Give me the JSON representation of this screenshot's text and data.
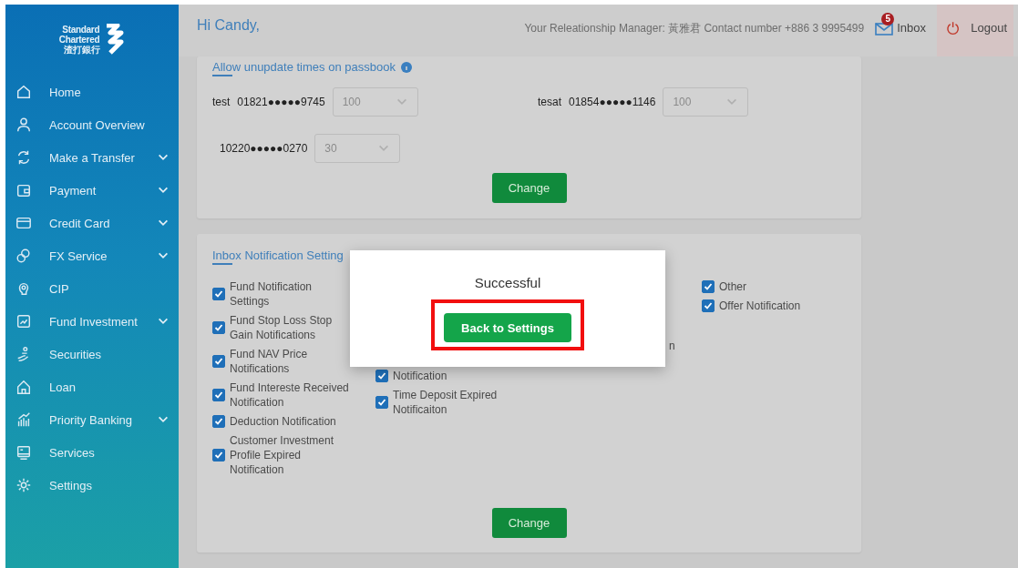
{
  "sidebar": {
    "logo": {
      "line_1": "Standard",
      "line_2": "Chartered",
      "line_3": "渣打銀行"
    },
    "items": [
      {
        "label": "Home",
        "expandable": false
      },
      {
        "label": "Account Overview",
        "expandable": false
      },
      {
        "label": "Make a Transfer",
        "expandable": true
      },
      {
        "label": "Payment",
        "expandable": true
      },
      {
        "label": "Credit Card",
        "expandable": true
      },
      {
        "label": "FX Service",
        "expandable": true
      },
      {
        "label": "CIP",
        "expandable": false
      },
      {
        "label": "Fund Investment",
        "expandable": true
      },
      {
        "label": "Securities",
        "expandable": false
      },
      {
        "label": "Loan",
        "expandable": false
      },
      {
        "label": "Priority Banking",
        "expandable": true
      },
      {
        "label": "Services",
        "expandable": false
      },
      {
        "label": "Settings",
        "expandable": false
      }
    ]
  },
  "header": {
    "greeting": "Hi Candy,",
    "manager_info": "Your Releationship Manager: 黃雅君 Contact number +886 3 9995499",
    "inbox_label": "Inbox",
    "inbox_count": "5",
    "logout_label": "Logout"
  },
  "passbook_card": {
    "title": "Allow unupdate times on passbook",
    "accounts": [
      {
        "name": "test",
        "number": "01821●●●●●9745",
        "value": "100"
      },
      {
        "name": "tesat",
        "number": "01854●●●●●1146",
        "value": "100"
      },
      {
        "number": "10220●●●●●0270",
        "value": "30"
      }
    ],
    "button": "Change"
  },
  "notification_card": {
    "title": "Inbox Notification Setting",
    "columns": [
      [
        {
          "kind": "checkbox",
          "label": "Fund Notification Settings",
          "checked": true
        },
        {
          "kind": "checkbox",
          "label": "Fund Stop Loss Stop Gain Notifications",
          "checked": true
        },
        {
          "kind": "checkbox",
          "label": "Fund NAV Price Notifications",
          "checked": true
        },
        {
          "kind": "checkbox",
          "label": "Fund Intereste Received Notification",
          "checked": true
        },
        {
          "kind": "checkbox",
          "label": "Deduction Notification",
          "checked": true
        },
        {
          "kind": "checkbox",
          "label": "Customer Investment Profile Expired Notification",
          "checked": true
        }
      ],
      [
        {
          "kind": "checkbox",
          "label": "Notification",
          "checked": true
        },
        {
          "kind": "checkbox",
          "label": "Time Deposit Expired Notificaiton",
          "checked": true
        }
      ],
      [
        {
          "kind": "fragment",
          "label": "n"
        }
      ],
      [
        {
          "kind": "checkbox",
          "label": "Other",
          "checked": true
        },
        {
          "kind": "checkbox",
          "label": "Offer Notification",
          "checked": true
        }
      ]
    ],
    "button": "Change"
  },
  "dialog": {
    "message": "Successful",
    "button": "Back to Settings",
    "highlighted": true
  }
}
